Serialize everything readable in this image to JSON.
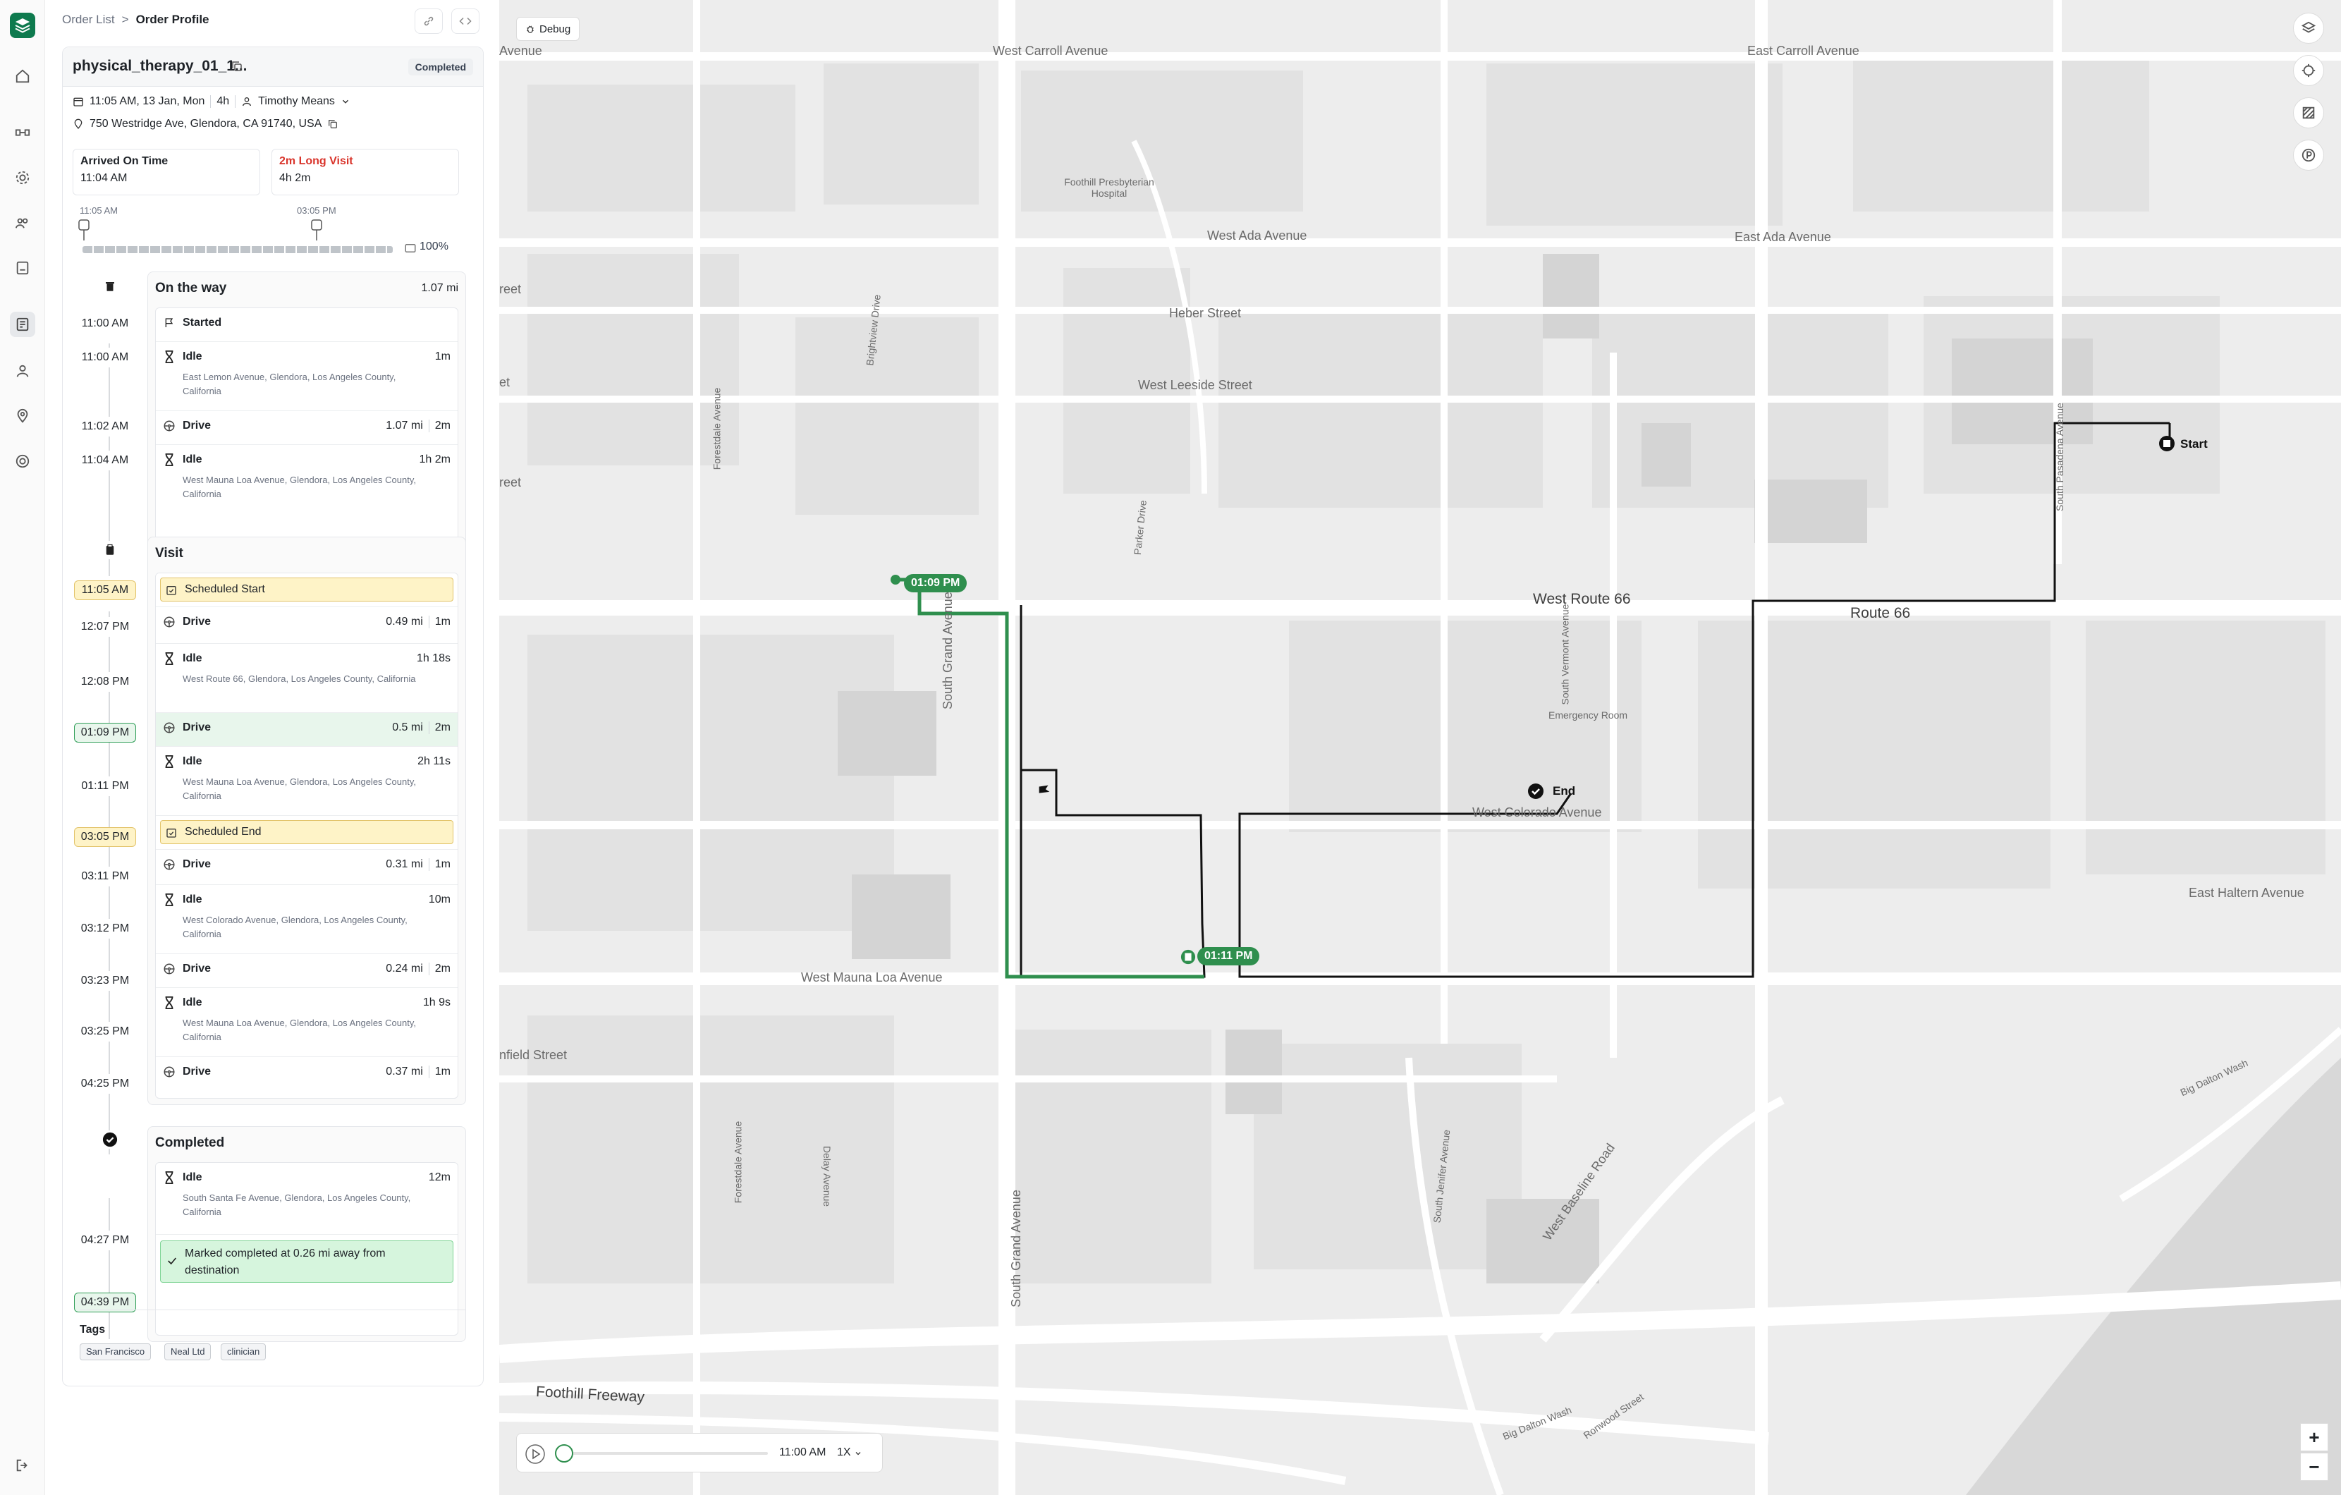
{
  "breadcrumb": {
    "parent": "Order List",
    "sep": ">",
    "current": "Order Profile"
  },
  "order": {
    "name": "physical_therapy_01_1...",
    "status": "Completed",
    "datetime": "11:05 AM, 13 Jan, Mon",
    "duration": "4h",
    "assignee": "Timothy Means",
    "address": "750 Westridge Ave, Glendora, CA 91740, USA",
    "arrival_title": "Arrived On Time",
    "arrival_value": "11:04 AM",
    "visit_title": "2m Long Visit",
    "visit_value": "4h 2m",
    "tl_start": "11:05 AM",
    "tl_end": "03:05 PM",
    "progress": "100%",
    "progress_fraction": 1.0
  },
  "sections": {
    "onway": {
      "title": "On the way",
      "distance": "1.07 mi",
      "times": [
        "11:00 AM",
        "11:00 AM",
        "11:02 AM",
        "11:04 AM"
      ],
      "rows": [
        {
          "label": "Started"
        },
        {
          "label": "Idle",
          "value": "1m",
          "addr": "East Lemon Avenue, Glendora, Los Angeles County, California"
        },
        {
          "label": "Drive",
          "dist": "1.07 mi",
          "value": "2m"
        },
        {
          "label": "Idle",
          "value": "1h 2m",
          "addr": "West Mauna Loa Avenue, Glendora, Los Angeles County, California"
        }
      ]
    },
    "visit": {
      "title": "Visit",
      "times": [
        "11:05 AM",
        "12:07 PM",
        "12:08 PM",
        "01:09 PM",
        "01:11 PM",
        "03:05 PM",
        "03:11 PM",
        "03:12 PM",
        "03:23 PM",
        "03:25 PM",
        "04:25 PM"
      ],
      "rows": [
        {
          "label": "Scheduled Start"
        },
        {
          "label": "Drive",
          "dist": "0.49 mi",
          "value": "1m"
        },
        {
          "label": "Idle",
          "value": "1h 18s",
          "addr": "West Route 66, Glendora, Los Angeles County, California"
        },
        {
          "label": "Drive",
          "dist": "0.5 mi",
          "value": "2m"
        },
        {
          "label": "Idle",
          "value": "2h 11s",
          "addr": "West Mauna Loa Avenue, Glendora, Los Angeles County, California"
        },
        {
          "label": "Scheduled End"
        },
        {
          "label": "Drive",
          "dist": "0.31 mi",
          "value": "1m"
        },
        {
          "label": "Idle",
          "value": "10m",
          "addr": "West Colorado Avenue, Glendora, Los Angeles County, California"
        },
        {
          "label": "Drive",
          "dist": "0.24 mi",
          "value": "2m"
        },
        {
          "label": "Idle",
          "value": "1h 9s",
          "addr": "West Mauna Loa Avenue, Glendora, Los Angeles County, California"
        },
        {
          "label": "Drive",
          "dist": "0.37 mi",
          "value": "1m"
        }
      ]
    },
    "completed": {
      "title": "Completed",
      "times": [
        "04:27 PM",
        "04:39 PM"
      ],
      "rows": [
        {
          "label": "Idle",
          "value": "12m",
          "addr": "South Santa Fe Avenue, Glendora, Los Angeles County, California"
        },
        {
          "label": "Marked completed at 0.26 mi away from destination"
        }
      ]
    }
  },
  "tags": {
    "title": "Tags",
    "items": [
      "San Francisco",
      "Neal Ltd",
      "clinician"
    ]
  },
  "map": {
    "debug": "Debug",
    "streets": {
      "carroll_w": "West Carroll Avenue",
      "carroll_e": "East Carroll Avenue",
      "ada_w": "West Ada Avenue",
      "ada_e": "East Ada Avenue",
      "heber": "Heber Street",
      "leeside": "West Leeside Street",
      "route66_w": "West Route 66",
      "route66": "Route 66",
      "colorado": "West Colorado Avenue",
      "haltern": "East Haltern Avenue",
      "maunaloa": "West Mauna Loa Avenue",
      "foothill": "Foothill Freeway",
      "grand": "South Grand Avenue",
      "grand2": "South Grand Avenue",
      "brightview": "Brightview Drive",
      "forestdale": "Forestdale Avenue",
      "forestdale2": "Forestdale Avenue",
      "parker": "Parker Drive",
      "vermont": "South Vermont Avenue",
      "pasadena": "South Pasadena Avenue",
      "delay": "Delay Avenue",
      "jenifer": "South Jenifer Avenue",
      "baseline": "West Baseline Road",
      "dalton": "Big Dalton Wash",
      "dalton2": "Big Dalton Wash",
      "ronwood": "Ronwood Street",
      "enfield": "nfield Street",
      "avenue_tl": "Avenue",
      "reet1": "reet",
      "reet2": "reet",
      "et": "et",
      "hospital": "Foothill Presbyterian Hospital",
      "emergency": "Emergency Room"
    },
    "markers": {
      "start": "Start",
      "end": "End",
      "t1": "01:09 PM",
      "t2": "01:11 PM"
    },
    "player": {
      "time": "11:00 AM",
      "speed": "1X"
    },
    "route_colors": {
      "active": "#2f8f4e",
      "path": "#111111"
    }
  }
}
